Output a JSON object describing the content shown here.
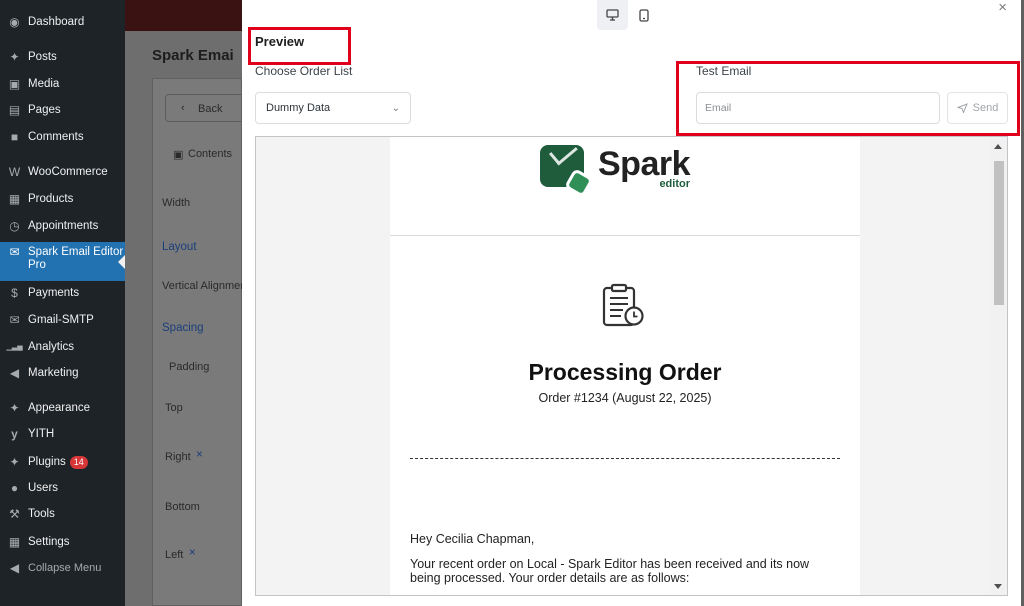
{
  "sidebar": {
    "items": [
      {
        "label": "Dashboard",
        "icon": "dashboard-icon",
        "glyph": "◉"
      },
      {
        "label": "Posts",
        "icon": "pin-icon",
        "glyph": "✦"
      },
      {
        "label": "Media",
        "icon": "media-icon",
        "glyph": "▣"
      },
      {
        "label": "Pages",
        "icon": "pages-icon",
        "glyph": "▤"
      },
      {
        "label": "Comments",
        "icon": "comments-icon",
        "glyph": "■"
      },
      {
        "label": "WooCommerce",
        "icon": "woocommerce-icon",
        "glyph": "W"
      },
      {
        "label": "Products",
        "icon": "products-icon",
        "glyph": "▦"
      },
      {
        "label": "Appointments",
        "icon": "clock-icon",
        "glyph": "◷"
      },
      {
        "label": "Spark Email Editor Pro",
        "icon": "spark-icon",
        "glyph": "✉"
      },
      {
        "label": "Payments",
        "icon": "payments-icon",
        "glyph": "$"
      },
      {
        "label": "Gmail-SMTP",
        "icon": "mail-icon",
        "glyph": "✉"
      },
      {
        "label": "Analytics",
        "icon": "analytics-icon",
        "glyph": "▁▃▅"
      },
      {
        "label": "Marketing",
        "icon": "megaphone-icon",
        "glyph": "◀"
      },
      {
        "label": "Appearance",
        "icon": "brush-icon",
        "glyph": "✦"
      },
      {
        "label": "YITH",
        "icon": "yith-icon",
        "glyph": "y"
      },
      {
        "label": "Plugins",
        "icon": "plugins-icon",
        "glyph": "✦",
        "badge": "14"
      },
      {
        "label": "Users",
        "icon": "users-icon",
        "glyph": "●"
      },
      {
        "label": "Tools",
        "icon": "tools-icon",
        "glyph": "⚒"
      },
      {
        "label": "Settings",
        "icon": "settings-icon",
        "glyph": "▦"
      },
      {
        "label": "Collapse Menu",
        "icon": "collapse-icon",
        "glyph": "◀"
      }
    ]
  },
  "background": {
    "page_title": "Spark Emai",
    "back_label": "Back",
    "contents_label": "Contents",
    "width_label": "Width",
    "layout_label": "Layout",
    "vertical_alignment_label": "Vertical Alignmer",
    "spacing_label": "Spacing",
    "padding_label": "Padding",
    "top_label": "Top",
    "right_label": "Right",
    "bottom_label": "Bottom",
    "left_label": "Left"
  },
  "modal": {
    "title": "Preview",
    "close_glyph": "×",
    "devices": [
      "desktop",
      "mobile"
    ],
    "order_list": {
      "label": "Choose Order List",
      "value": "Dummy Data"
    },
    "test_email": {
      "label": "Test Email",
      "placeholder": "Email",
      "send_label": "Send"
    }
  },
  "email": {
    "logo_word": "Spark",
    "logo_sub": "editor",
    "heading": "Processing Order",
    "order_line": "Order #1234 (August 22, 2025)",
    "greeting": "Hey Cecilia Chapman,",
    "body": "Your recent order on Local - Spark Editor has been received and its now being processed. Your order details are as follows:"
  },
  "colors": {
    "highlight": "#e0001b",
    "wp_active": "#2271b1",
    "brand_green": "#1f5c3c"
  }
}
